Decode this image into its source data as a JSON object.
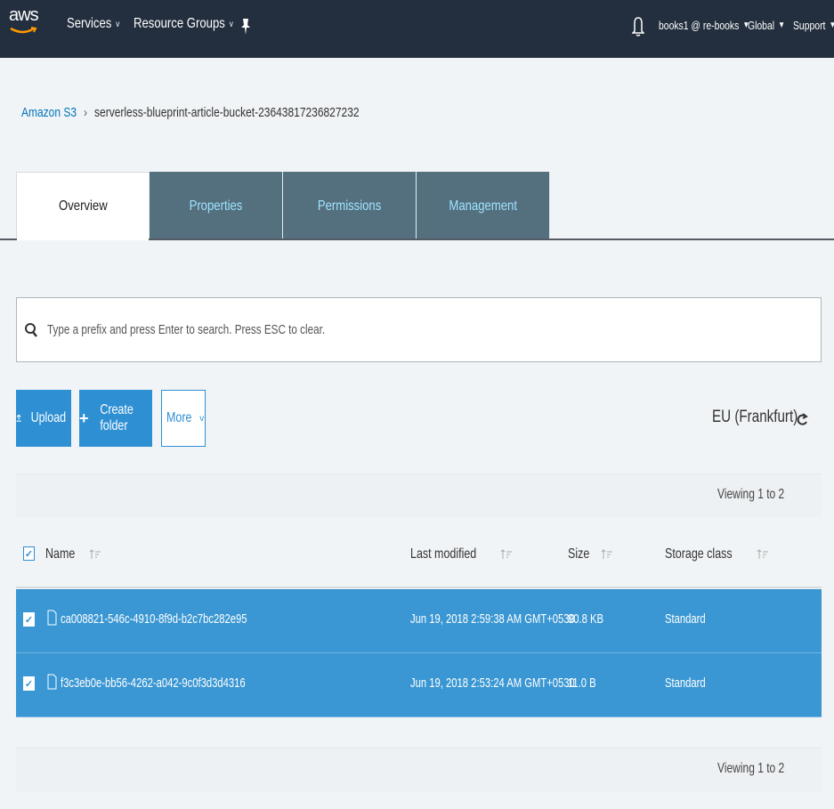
{
  "topnav": {
    "logo_text": "aws",
    "services_label": "Services",
    "resource_groups_label": "Resource Groups",
    "account_label": "books1 @ re-books",
    "region_label": "Global",
    "support_label": "Support"
  },
  "breadcrumb": {
    "root": "Amazon S3",
    "separator": "›",
    "bucket": "serverless-blueprint-article-bucket-23643817236827232"
  },
  "tabs": [
    {
      "label": "Overview",
      "active": true
    },
    {
      "label": "Properties",
      "active": false
    },
    {
      "label": "Permissions",
      "active": false
    },
    {
      "label": "Management",
      "active": false
    }
  ],
  "search": {
    "placeholder": "Type a prefix and press Enter to search. Press ESC to clear."
  },
  "actions": {
    "upload_label": "Upload",
    "create_folder_label": "Create folder",
    "more_label": "More"
  },
  "region": "EU (Frankfurt)",
  "viewing": "Viewing 1 to 2",
  "table": {
    "columns": {
      "name": "Name",
      "last_modified": "Last modified",
      "size": "Size",
      "storage_class": "Storage class"
    },
    "rows": [
      {
        "name": "ca008821-546c-4910-8f9d-b2c7bc282e95",
        "last_modified": "Jun 19, 2018 2:59:38 AM GMT+0530",
        "size": "90.8 KB",
        "storage_class": "Standard"
      },
      {
        "name": "f3c3eb0e-bb56-4262-a042-9c0f3d3d4316",
        "last_modified": "Jun 19, 2018 2:53:24 AM GMT+0530",
        "size": "11.0 B",
        "storage_class": "Standard"
      }
    ]
  },
  "colors": {
    "nav_bg": "#232f3e",
    "accent": "#2e8fd3",
    "tab_inactive": "#546f7e",
    "selected_row": "#3a97d3"
  }
}
